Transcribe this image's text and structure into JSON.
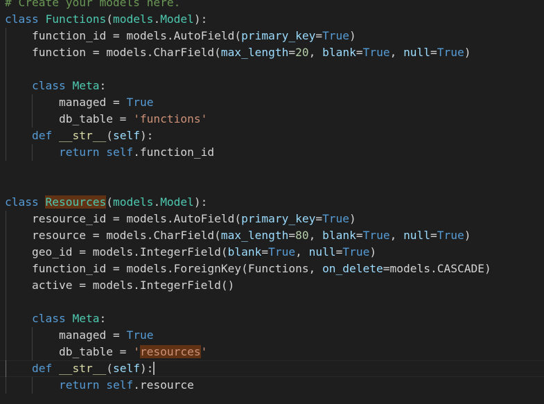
{
  "editor": {
    "lines": [
      {
        "indent": 0,
        "tokens": [
          {
            "t": "# Create your models here.",
            "c": "comment"
          }
        ]
      },
      {
        "indent": 0,
        "tokens": [
          {
            "t": "class ",
            "c": "kw"
          },
          {
            "t": "Functions",
            "c": "cls"
          },
          {
            "t": "(",
            "c": "plain"
          },
          {
            "t": "models",
            "c": "cls"
          },
          {
            "t": ".",
            "c": "plain"
          },
          {
            "t": "Model",
            "c": "cls"
          },
          {
            "t": "):",
            "c": "plain"
          }
        ]
      },
      {
        "indent": 1,
        "tokens": [
          {
            "t": "function_id",
            "c": "plain"
          },
          {
            "t": " = models.AutoField(",
            "c": "plain"
          },
          {
            "t": "primary_key",
            "c": "var"
          },
          {
            "t": "=",
            "c": "plain"
          },
          {
            "t": "True",
            "c": "kw"
          },
          {
            "t": ")",
            "c": "plain"
          }
        ]
      },
      {
        "indent": 1,
        "tokens": [
          {
            "t": "function",
            "c": "plain"
          },
          {
            "t": " = models.CharField(",
            "c": "plain"
          },
          {
            "t": "max_length",
            "c": "var"
          },
          {
            "t": "=",
            "c": "plain"
          },
          {
            "t": "20",
            "c": "num"
          },
          {
            "t": ", ",
            "c": "plain"
          },
          {
            "t": "blank",
            "c": "var"
          },
          {
            "t": "=",
            "c": "plain"
          },
          {
            "t": "True",
            "c": "kw"
          },
          {
            "t": ", ",
            "c": "plain"
          },
          {
            "t": "null",
            "c": "var"
          },
          {
            "t": "=",
            "c": "plain"
          },
          {
            "t": "True",
            "c": "kw"
          },
          {
            "t": ")",
            "c": "plain"
          }
        ]
      },
      {
        "indent": 1,
        "tokens": []
      },
      {
        "indent": 1,
        "tokens": [
          {
            "t": "class ",
            "c": "kw"
          },
          {
            "t": "Meta",
            "c": "cls"
          },
          {
            "t": ":",
            "c": "plain"
          }
        ]
      },
      {
        "indent": 2,
        "tokens": [
          {
            "t": "managed",
            "c": "plain"
          },
          {
            "t": " = ",
            "c": "plain"
          },
          {
            "t": "True",
            "c": "kw"
          }
        ]
      },
      {
        "indent": 2,
        "tokens": [
          {
            "t": "db_table",
            "c": "plain"
          },
          {
            "t": " = ",
            "c": "plain"
          },
          {
            "t": "'functions'",
            "c": "str"
          }
        ]
      },
      {
        "indent": 1,
        "tokens": [
          {
            "t": "def ",
            "c": "kw"
          },
          {
            "t": "__str__",
            "c": "fn"
          },
          {
            "t": "(",
            "c": "plain"
          },
          {
            "t": "self",
            "c": "var"
          },
          {
            "t": "):",
            "c": "plain"
          }
        ]
      },
      {
        "indent": 2,
        "tokens": [
          {
            "t": "return ",
            "c": "kw"
          },
          {
            "t": "self",
            "c": "kw"
          },
          {
            "t": ".function_id",
            "c": "plain"
          }
        ]
      },
      {
        "indent": 0,
        "tokens": []
      },
      {
        "indent": 0,
        "tokens": []
      },
      {
        "indent": 0,
        "tokens": [
          {
            "t": "class ",
            "c": "kw"
          },
          {
            "t": "Resources",
            "c": "cls",
            "hl": true
          },
          {
            "t": "(",
            "c": "plain"
          },
          {
            "t": "models",
            "c": "cls"
          },
          {
            "t": ".",
            "c": "plain"
          },
          {
            "t": "Model",
            "c": "cls"
          },
          {
            "t": "):",
            "c": "plain"
          }
        ]
      },
      {
        "indent": 1,
        "tokens": [
          {
            "t": "resource_id",
            "c": "plain"
          },
          {
            "t": " = models.AutoField(",
            "c": "plain"
          },
          {
            "t": "primary_key",
            "c": "var"
          },
          {
            "t": "=",
            "c": "plain"
          },
          {
            "t": "True",
            "c": "kw"
          },
          {
            "t": ")",
            "c": "plain"
          }
        ]
      },
      {
        "indent": 1,
        "tokens": [
          {
            "t": "resource",
            "c": "plain"
          },
          {
            "t": " = models.CharField(",
            "c": "plain"
          },
          {
            "t": "max_length",
            "c": "var"
          },
          {
            "t": "=",
            "c": "plain"
          },
          {
            "t": "80",
            "c": "num"
          },
          {
            "t": ", ",
            "c": "plain"
          },
          {
            "t": "blank",
            "c": "var"
          },
          {
            "t": "=",
            "c": "plain"
          },
          {
            "t": "True",
            "c": "kw"
          },
          {
            "t": ", ",
            "c": "plain"
          },
          {
            "t": "null",
            "c": "var"
          },
          {
            "t": "=",
            "c": "plain"
          },
          {
            "t": "True",
            "c": "kw"
          },
          {
            "t": ")",
            "c": "plain"
          }
        ]
      },
      {
        "indent": 1,
        "tokens": [
          {
            "t": "geo_id",
            "c": "plain"
          },
          {
            "t": " = models.IntegerField(",
            "c": "plain"
          },
          {
            "t": "blank",
            "c": "var"
          },
          {
            "t": "=",
            "c": "plain"
          },
          {
            "t": "True",
            "c": "kw"
          },
          {
            "t": ", ",
            "c": "plain"
          },
          {
            "t": "null",
            "c": "var"
          },
          {
            "t": "=",
            "c": "plain"
          },
          {
            "t": "True",
            "c": "kw"
          },
          {
            "t": ")",
            "c": "plain"
          }
        ]
      },
      {
        "indent": 1,
        "tokens": [
          {
            "t": "function_id",
            "c": "plain"
          },
          {
            "t": " = models.ForeignKey(Functions, ",
            "c": "plain"
          },
          {
            "t": "on_delete",
            "c": "var"
          },
          {
            "t": "=models.CASCADE)",
            "c": "plain"
          }
        ]
      },
      {
        "indent": 1,
        "tokens": [
          {
            "t": "active",
            "c": "plain"
          },
          {
            "t": " = models.IntegerField()",
            "c": "plain"
          }
        ]
      },
      {
        "indent": 1,
        "tokens": []
      },
      {
        "indent": 1,
        "tokens": [
          {
            "t": "class ",
            "c": "kw"
          },
          {
            "t": "Meta",
            "c": "cls"
          },
          {
            "t": ":",
            "c": "plain"
          }
        ]
      },
      {
        "indent": 2,
        "tokens": [
          {
            "t": "managed",
            "c": "plain"
          },
          {
            "t": " = ",
            "c": "plain"
          },
          {
            "t": "True",
            "c": "kw"
          }
        ]
      },
      {
        "indent": 2,
        "tokens": [
          {
            "t": "db_table",
            "c": "plain"
          },
          {
            "t": " = ",
            "c": "plain"
          },
          {
            "t": "'",
            "c": "str"
          },
          {
            "t": "resources",
            "c": "str",
            "hl": true
          },
          {
            "t": "'",
            "c": "str"
          }
        ]
      },
      {
        "indent": 1,
        "current": true,
        "cursor_after": true,
        "tokens": [
          {
            "t": "def ",
            "c": "kw"
          },
          {
            "t": "__str__",
            "c": "fn"
          },
          {
            "t": "(",
            "c": "plain"
          },
          {
            "t": "self",
            "c": "var"
          },
          {
            "t": "):",
            "c": "plain"
          }
        ]
      },
      {
        "indent": 2,
        "tokens": [
          {
            "t": "return ",
            "c": "kw"
          },
          {
            "t": "self",
            "c": "kw"
          },
          {
            "t": ".resource",
            "c": "plain"
          }
        ]
      }
    ]
  }
}
